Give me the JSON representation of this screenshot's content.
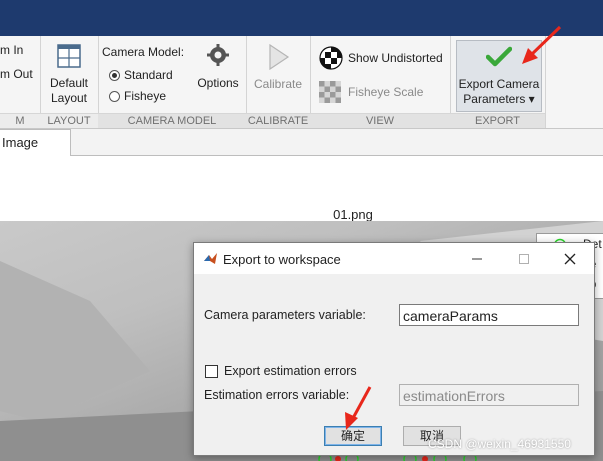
{
  "ribbon": {
    "zoom": {
      "zoom_in": "m In",
      "zoom_out": "m Out",
      "footer": "M"
    },
    "layout": {
      "default_layout_line1": "Default",
      "default_layout_line2": "Layout",
      "footer": "LAYOUT"
    },
    "camera_model": {
      "title": "Camera Model:",
      "options_list": [
        "Standard",
        "Fisheye"
      ],
      "selected": "Standard",
      "options_button": "Options",
      "footer": "CAMERA MODEL"
    },
    "calibrate": {
      "button": "Calibrate",
      "footer": "CALIBRATE"
    },
    "view": {
      "show_undistorted": "Show Undistorted",
      "fisheye_scale": "Fisheye Scale",
      "footer": "VIEW"
    },
    "export": {
      "button_line1": "Export Camera",
      "button_line2": "Parameters ▾",
      "footer": "EXPORT"
    }
  },
  "tabs": [
    {
      "label": "Image"
    }
  ],
  "image_view": {
    "title": "01.png",
    "legend_lines": [
      "Det",
      "he",
      "ep"
    ]
  },
  "dialog": {
    "title": "Export to workspace",
    "camera_params_label": "Camera parameters variable:",
    "camera_params_value": "cameraParams",
    "export_errors_label": "Export estimation errors",
    "export_errors_checked": false,
    "errors_variable_label": "Estimation errors variable:",
    "errors_variable_value": "estimationErrors",
    "ok_button": "确定",
    "cancel_button": "取消"
  },
  "watermark": "CSDN @weixin_46931550",
  "colors": {
    "titlebar": "#1e3a6e",
    "annotation_arrow": "#e8271b",
    "check_green": "#3aa83a"
  }
}
